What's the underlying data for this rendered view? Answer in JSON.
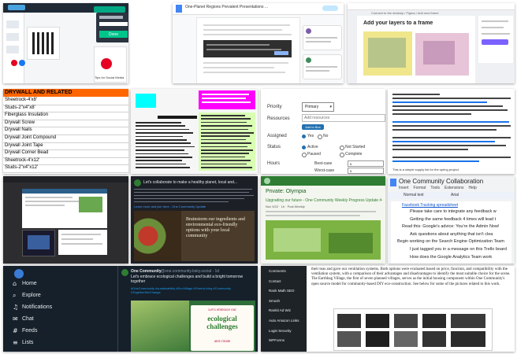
{
  "tile1": {
    "button": "Done",
    "link": "Tips for Social Media"
  },
  "tile2": {
    "header": "One-Planet Regions Prevalent Presentations ..."
  },
  "tile3": {
    "heading": "Add your layers to a frame",
    "link": "Connect to the desktop / Figma / Add new frame"
  },
  "tile4": {
    "header": "DRYWALL AND RELATED",
    "rows": [
      "Sheetrock-4'x8'",
      "Studs-2\"x4\"x8'",
      "Fiberglass Insulation",
      "Drywall Screw",
      "Drywall Nails",
      "Drywall Joint Compound",
      "Drywall Joint Tape",
      "Drywall Corner Bead",
      "Sheetrock-4'x12'",
      "Studs-2\"x4\"x12'"
    ]
  },
  "tile6": {
    "priority_label": "Priority",
    "priority_value": "Primary",
    "resources_label": "Resources",
    "resources_placeholder": "Add resources",
    "add_button": "Add to Box",
    "assigned_label": "Assigned",
    "yes": "Yes",
    "no": "No",
    "status_label": "Status",
    "status_active": "Active",
    "status_not_started": "Not Started",
    "status_paused": "Paused",
    "status_complete": "Complete",
    "hours_label": "Hours",
    "best_case": "Best-case",
    "worst_case": "Worst-case",
    "hours_best": "0",
    "hours_worst": "0"
  },
  "tile7": {
    "footer": "This is a simple supply list for the spring project"
  },
  "tile9": {
    "title": "Let's collaborate to make a healthy planet, local and...",
    "link": "Learn more and join here - One Community Update",
    "banner": "Brainstorm our ingredients and environmental eco-friendly options with your local community"
  },
  "tile10": {
    "title": "Private: Olympia",
    "subtitle": "Upgrading our future - One Community Weekly Progress Update #420",
    "meta": "Nov 9/22 · 1h · Post Weekly"
  },
  "tile11": {
    "title": "One Community Collaboration",
    "menu": [
      "Insert",
      "Format",
      "Tools",
      "Extensions",
      "Help"
    ],
    "style": "Normal text",
    "font": "Arial",
    "link_line": "Facebook Tracking spreadsheet",
    "items": [
      "Please take care to integrate any feedback w",
      "Getting the same feedback 4 times will lead t",
      "Read this: Google's advice: You're the Admin Now!",
      "Ask questions about anything that isn't clea",
      "Begin working on the Search Engine Optimization Team",
      "I just tagged you in a message on this Trello board",
      "How does the Google Analytics Team work"
    ]
  },
  "tile12": {
    "nav": [
      "Home",
      "Explore",
      "Notifications",
      "Chat",
      "Feeds",
      "Lists"
    ],
    "account": "One Community",
    "handle": "@one.community.bsky.social · 1d",
    "body": "Let's embrace ecological challenges and build a bright tomorrow together",
    "hashtags": "#OneCommunity #sustainability #EcoVillage #GreenLiving #Community #TogetherWeChange",
    "image_text_top": "Let's embrace our",
    "image_text_big": "ecological challenges",
    "image_text_bottom": "and create"
  },
  "tile13": {
    "sidebar": [
      "Comments",
      "Contact",
      "Rank Math SEO",
      "Smush",
      "Rankit Ad Wiz",
      "Auto Amazon Links",
      "Login Security",
      "WPForms"
    ],
    "body": "their teas and gave our ventilation systems. Both options were evaluated based on price, function, and compatibility with the ventilation system, with a comparison of their advantages and disadvantages to identify the most suitable choice for the scene. The Earthbag Village, the first of seven planned villages, serves as the initial housing component within One Community's open source model for community-based DIY eco-construction. See below for some of the pictures related to this work."
  },
  "colors": {
    "spreadsheet_header": "#ff6600",
    "magenta_block": "#ff00ff",
    "cyan_block": "#00ffff",
    "lime_sheet": "#d9ffb3",
    "twitter_blue": "#1d9bf0",
    "wp_sidebar": "#1d2327"
  }
}
